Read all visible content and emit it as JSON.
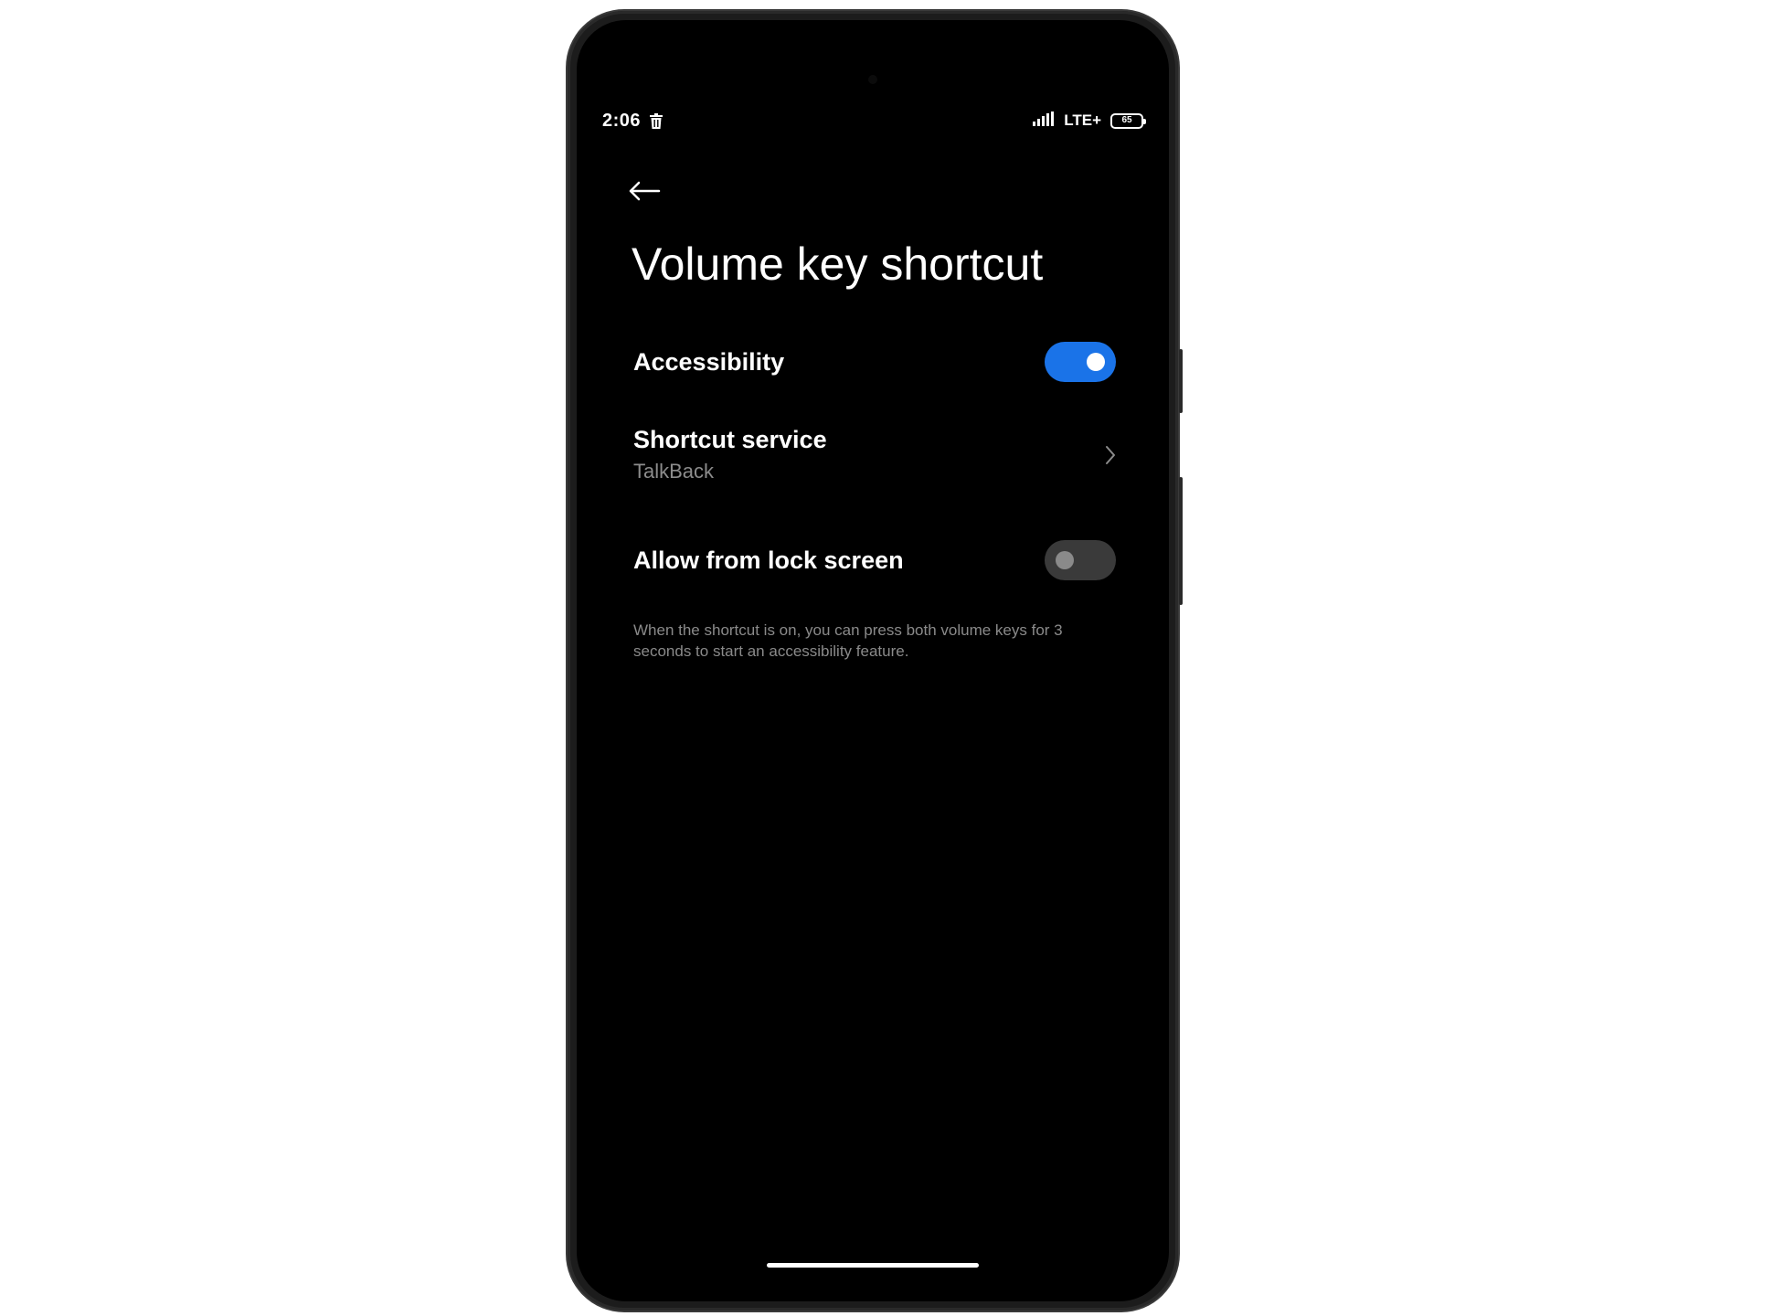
{
  "status_bar": {
    "time": "2:06",
    "network": "LTE+",
    "battery": "65"
  },
  "page": {
    "title": "Volume key shortcut"
  },
  "settings": {
    "accessibility": {
      "label": "Accessibility",
      "enabled": true
    },
    "shortcut_service": {
      "label": "Shortcut service",
      "value": "TalkBack"
    },
    "lock_screen": {
      "label": "Allow from lock screen",
      "enabled": false
    }
  },
  "footnote": "When the shortcut is on, you can press both volume keys for 3 seconds to start an accessibility feature.",
  "colors": {
    "accent": "#1a73e8",
    "background": "#000000",
    "secondary_text": "#8c8c8c"
  },
  "icons": {
    "back": "back-arrow-icon",
    "chevron": "chevron-right-icon",
    "status_trash": "trash-icon",
    "signal": "signal-icon",
    "battery": "battery-icon"
  }
}
